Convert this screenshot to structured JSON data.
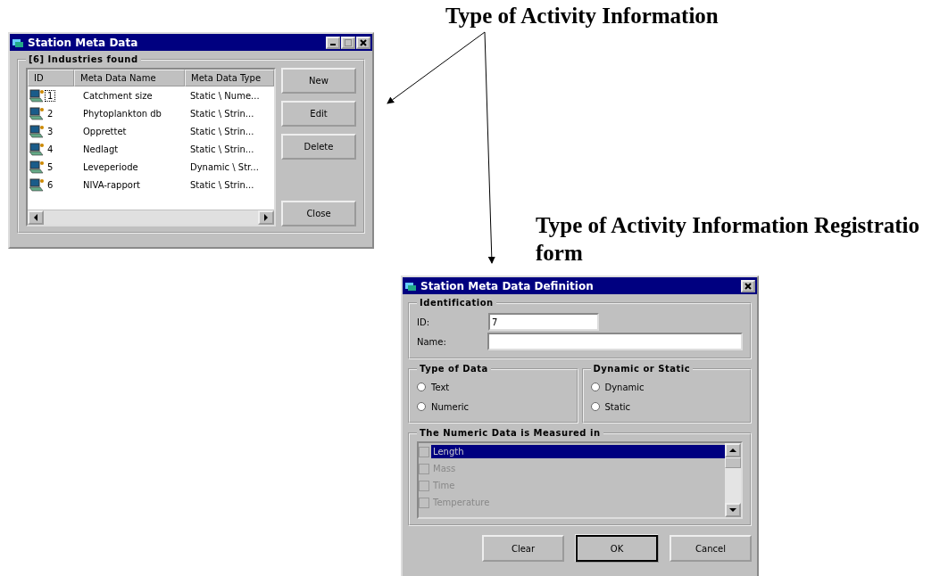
{
  "captions": [
    {
      "lines": [
        "Type of Activity Information"
      ]
    },
    {
      "lines": [
        "Type of Activity Information Registratio",
        "form"
      ]
    }
  ],
  "list_window": {
    "title": "Station Meta Data",
    "group_label": "[6] Industries found",
    "columns": [
      "ID",
      "Meta Data Name",
      "Meta Data Type"
    ],
    "rows": [
      {
        "id": "1",
        "name": "Catchment size",
        "type": "Static \\ Nume...",
        "focused": true
      },
      {
        "id": "2",
        "name": "Phytoplankton db",
        "type": "Static \\ Strin...",
        "focused": false
      },
      {
        "id": "3",
        "name": "Opprettet",
        "type": "Static \\ Strin...",
        "focused": false
      },
      {
        "id": "4",
        "name": "Nedlagt",
        "type": "Static \\ Strin...",
        "focused": false
      },
      {
        "id": "5",
        "name": "Leveperiode",
        "type": "Dynamic \\ Str...",
        "focused": false
      },
      {
        "id": "6",
        "name": "NIVA-rapport",
        "type": "Static \\ Strin...",
        "focused": false
      }
    ],
    "buttons": [
      "New",
      "Edit",
      "Delete"
    ],
    "close_button": "Close"
  },
  "form_window": {
    "title": "Station Meta Data Definition",
    "identification": {
      "label": "Identification",
      "id_label": "ID:",
      "id_value": "7",
      "name_label": "Name:"
    },
    "type_of_data": {
      "label": "Type of Data",
      "options": [
        {
          "label": "Text",
          "selected": false
        },
        {
          "label": "Numeric",
          "selected": false
        }
      ]
    },
    "dynamic_or_static": {
      "label": "Dynamic or Static",
      "options": [
        {
          "label": "Dynamic",
          "selected": false
        },
        {
          "label": "Static",
          "selected": false
        }
      ]
    },
    "units": {
      "label": "The Numeric Data is Measured in",
      "items": [
        {
          "label": "Length",
          "checked": false,
          "selected": true
        },
        {
          "label": "Mass",
          "checked": false,
          "selected": false
        },
        {
          "label": "Time",
          "checked": false,
          "selected": false
        },
        {
          "label": "Temperature",
          "checked": false,
          "selected": false
        }
      ]
    },
    "buttons": [
      "Clear",
      "OK",
      "Cancel"
    ]
  }
}
